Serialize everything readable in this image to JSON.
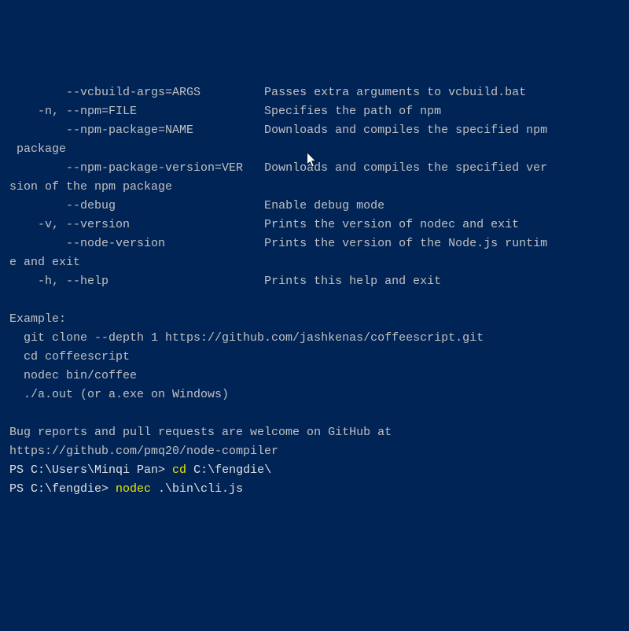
{
  "options": [
    {
      "flag": "        --vcbuild-args=ARGS",
      "desc": "         Passes extra arguments to vcbuild.bat"
    },
    {
      "flag": "    -n, --npm=FILE",
      "desc": "                  Specifies the path of npm"
    },
    {
      "flag": "        --npm-package=NAME",
      "desc": "          Downloads and compiles the specified npm"
    },
    {
      "flag": " package",
      "desc": ""
    },
    {
      "flag": "        --npm-package-version=VER",
      "desc": "   Downloads and compiles the specified ver"
    },
    {
      "flag": "sion of the npm package",
      "desc": ""
    },
    {
      "flag": "        --debug",
      "desc": "                     Enable debug mode"
    },
    {
      "flag": "    -v, --version",
      "desc": "                   Prints the version of nodec and exit"
    },
    {
      "flag": "        --node-version",
      "desc": "              Prints the version of the Node.js runtim"
    },
    {
      "flag": "e and exit",
      "desc": ""
    },
    {
      "flag": "    -h, --help",
      "desc": "                      Prints this help and exit"
    }
  ],
  "example_header": "Example:",
  "example_lines": [
    "  git clone --depth 1 https://github.com/jashkenas/coffeescript.git",
    "  cd coffeescript",
    "  nodec bin/coffee",
    "  ./a.out (or a.exe on Windows)"
  ],
  "bugs_line1": "Bug reports and pull requests are welcome on GitHub at",
  "bugs_line2": "https://github.com/pmq20/node-compiler",
  "prompt1": {
    "ps": "PS C:\\Users\\Minqi Pan> ",
    "cmd1": "cd ",
    "cmd2": "C:\\fengdie\\"
  },
  "prompt2": {
    "ps": "PS C:\\fengdie> ",
    "cmd1": "nodec ",
    "cmd2": ".\\bin\\cli.js"
  }
}
